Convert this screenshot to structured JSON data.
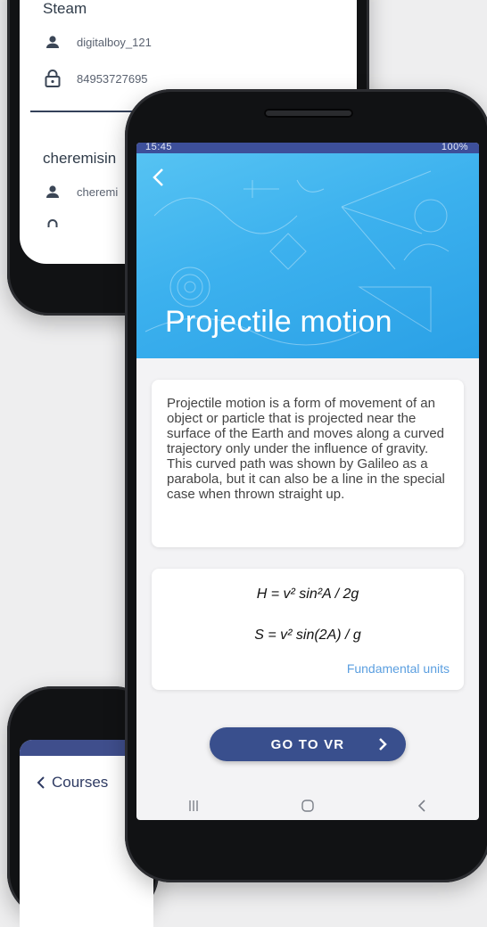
{
  "back_phone_top": {
    "accounts": [
      {
        "title": "Steam",
        "username": "digitalboy_121",
        "password": "84953727695"
      },
      {
        "title": "cheremisin",
        "username": "cheremi"
      }
    ],
    "icons": [
      "person-icon",
      "lock-icon"
    ]
  },
  "back_phone_bottom": {
    "back_label": "Courses"
  },
  "main_phone": {
    "status_bar": {
      "time": "15:45",
      "battery": "100%"
    },
    "hero": {
      "title": "Projectile motion"
    },
    "description": "Projectile motion is a form of movement of an object or particle that is projected near the surface of the Earth and moves along a curved trajectory only under the influence of gravity. This curved path was shown by Galileo as a parabola, but it can also be a line in the special case when thrown straight up.",
    "formulas": {
      "f1": "H = v² sin²A / 2g",
      "f2": "S = v² sin(2A) / g",
      "link_label": "Fundamental units"
    },
    "cta_label": "GO TO VR",
    "nav": {
      "recents": "|||",
      "home": "○",
      "back": "‹"
    },
    "colors": {
      "accent": "#394f8d",
      "hero": "#3cb1ee",
      "link": "#5b9fe0"
    }
  }
}
